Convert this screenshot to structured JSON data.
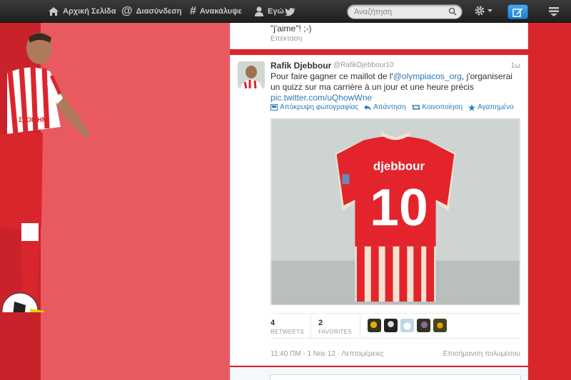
{
  "nav": {
    "home": "Αρχική Σελίδα",
    "connect": "Διασύνδεση",
    "discover": "Ανακάλυψε",
    "me": "Εγώ"
  },
  "search": {
    "placeholder": "Αναζήτηση"
  },
  "previous_tweet": {
    "text": "\"j'aime\"! ;-)",
    "expand": "Επέκταση"
  },
  "tweet": {
    "name": "Rafik Djebbour",
    "handle": "@RafikDjebbour10",
    "time": "1ω",
    "text_before": "Pour faire gagner ce maillot de l'",
    "mention": "@olympiacos_org",
    "text_after": ", j'organiserai un quizz sur ma carrière à un jour et une heure précis",
    "link": "pic.twitter.com/uQhowWne",
    "actions": {
      "hide_photo": "Απόκρυψη φωτογραφίας",
      "reply": "Απάντηση",
      "retweet": "Κοινοποίηση",
      "favorite": "Αγαπημένο"
    },
    "photo": {
      "shirt_name": "djebbour",
      "shirt_number": "10"
    },
    "stats": {
      "retweets": "4",
      "retweets_label": "RETWEETS",
      "favorites": "2",
      "favorites_label": "FAVORITES"
    },
    "timestamp": "11:40 ΠΜ - 1 Νοε 12",
    "details": "Λεπτομέρειες",
    "flag_media": "Επισήμανση πολυμέσου"
  },
  "colors": {
    "accent": "#2b7bb9",
    "background": "#d9262c",
    "compose": "#1c7fd1"
  }
}
